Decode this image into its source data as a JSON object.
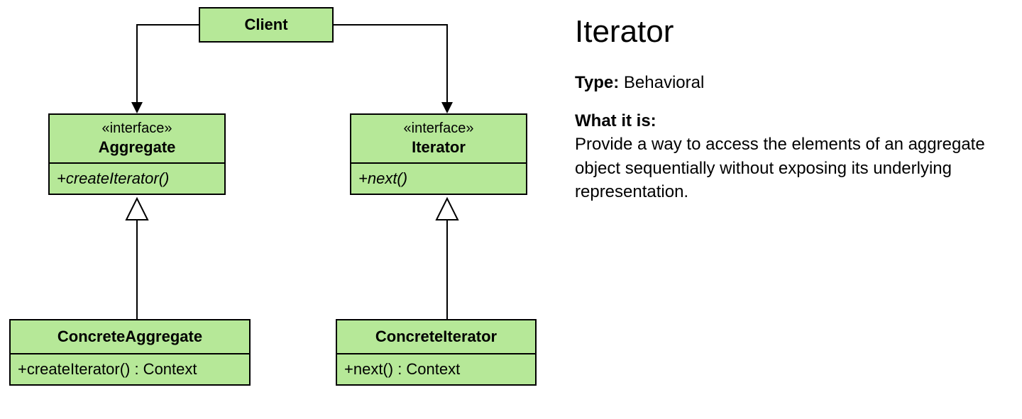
{
  "diagram": {
    "client": {
      "name": "Client"
    },
    "aggregate": {
      "stereotype": "«interface»",
      "name": "Aggregate",
      "method": "+createIterator()"
    },
    "iterator": {
      "stereotype": "«interface»",
      "name": "Iterator",
      "method": "+next()"
    },
    "concreteAggregate": {
      "name": "ConcreteAggregate",
      "method": "+createIterator() : Context"
    },
    "concreteIterator": {
      "name": "ConcreteIterator",
      "method": "+next() : Context"
    }
  },
  "info": {
    "title": "Iterator",
    "typeLabel": "Type:",
    "typeValue": " Behavioral",
    "whatLabel": "What it is:",
    "whatText": "Provide a way to access the elements of an aggregate object sequentially without exposing its underlying representation."
  }
}
